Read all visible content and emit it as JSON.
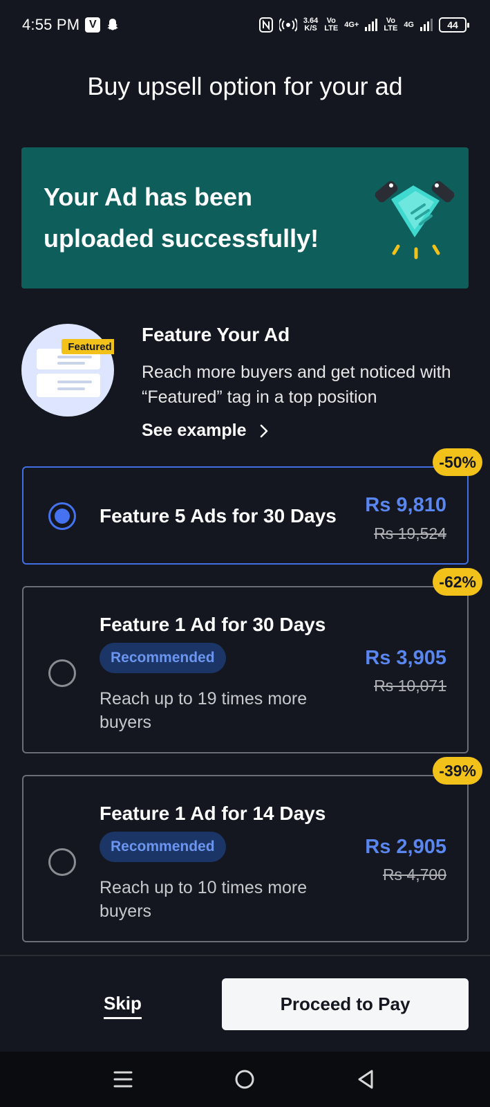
{
  "status_bar": {
    "time": "4:55 PM",
    "speed_value": "3.64",
    "speed_unit": "K/S",
    "net1": "4G+",
    "net2": "4G",
    "vo": "Vo",
    "lte": "LTE",
    "battery": "44"
  },
  "page": {
    "title": "Buy upsell option for your ad"
  },
  "banner": {
    "message": "Your Ad has been uploaded successfully!",
    "bg_color": "#0e5f5c",
    "icon": "handshake-icon"
  },
  "feature": {
    "illustration_tag": "Featured",
    "title": "Feature Your Ad",
    "description": "Reach more buyers and get noticed with “Featured” tag in a top position",
    "see_example": "See example"
  },
  "options": [
    {
      "title": "Feature 5 Ads for 30 Days",
      "price": "Rs 9,810",
      "old_price": "Rs 19,524",
      "discount": "-50%",
      "selected": true
    },
    {
      "title": "Feature 1 Ad for 30 Days",
      "badge": "Recommended",
      "subtitle": "Reach up to 19 times more buyers",
      "price": "Rs 3,905",
      "old_price": "Rs 10,071",
      "discount": "-62%",
      "selected": false
    },
    {
      "title": "Feature 1 Ad for 14 Days",
      "badge": "Recommended",
      "subtitle": "Reach up to 10 times more buyers",
      "price": "Rs 2,905",
      "old_price": "Rs 4,700",
      "discount": "-39%",
      "selected": false
    }
  ],
  "footer": {
    "skip": "Skip",
    "proceed": "Proceed to Pay"
  },
  "colors": {
    "background": "#141720",
    "accent_blue": "#4472f0",
    "discount_yellow": "#f2c21b"
  }
}
